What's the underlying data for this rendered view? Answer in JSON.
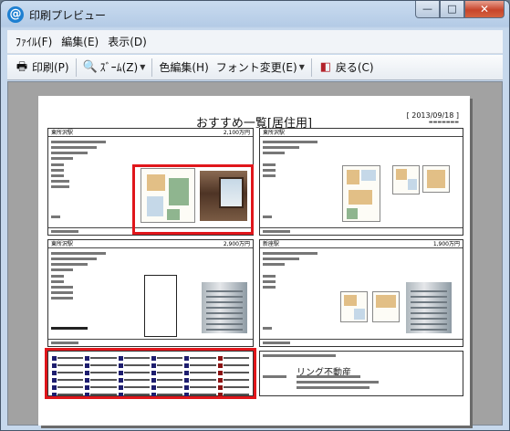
{
  "window": {
    "title": "印刷プレビュー",
    "app_icon": "@"
  },
  "controls": {
    "minimize": "—",
    "maximize": "□",
    "close": "✕"
  },
  "menu": [
    {
      "label": "ﾌｧｲﾙ(F)"
    },
    {
      "label": "編集(E)"
    },
    {
      "label": "表示(D)"
    }
  ],
  "toolbar": {
    "print": "印刷(P)",
    "zoom": "ｽﾞｰﾑ(Z)",
    "color_edit": "色編集(H)",
    "font_change": "フォント変更(E)",
    "back": "戻る(C)"
  },
  "page": {
    "title": "おすすめ一覧[居住用]",
    "date": "[ 2013/09/18 ]",
    "cards": [
      {
        "area": "東所沢駅",
        "price": "2,100万円"
      },
      {
        "area": "東所沢駅",
        "price": ""
      },
      {
        "area": "東所沢駅",
        "price": "2,900万円"
      },
      {
        "area": "新座駅",
        "price": "1,900万円"
      }
    ],
    "company": "リング不動産"
  }
}
